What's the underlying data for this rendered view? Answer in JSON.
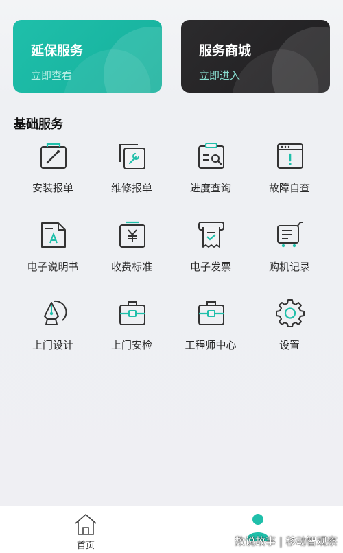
{
  "colors": {
    "accent": "#1fbfaa",
    "dark_card": "#242325",
    "icon_stroke": "#333333"
  },
  "cards": [
    {
      "title": "延保服务",
      "subtitle": "立即查看"
    },
    {
      "title": "服务商城",
      "subtitle": "立即进入"
    }
  ],
  "section": {
    "title": "基础服务"
  },
  "services": [
    {
      "label": "安装报单",
      "icon": "install-report-icon"
    },
    {
      "label": "维修报单",
      "icon": "repair-report-icon"
    },
    {
      "label": "进度查询",
      "icon": "progress-query-icon"
    },
    {
      "label": "故障自查",
      "icon": "fault-check-icon"
    },
    {
      "label": "电子说明书",
      "icon": "e-manual-icon"
    },
    {
      "label": "收费标准",
      "icon": "fee-standard-icon"
    },
    {
      "label": "电子发票",
      "icon": "e-invoice-icon"
    },
    {
      "label": "购机记录",
      "icon": "purchase-record-icon"
    },
    {
      "label": "上门设计",
      "icon": "home-design-icon"
    },
    {
      "label": "上门安检",
      "icon": "home-inspection-icon"
    },
    {
      "label": "工程师中心",
      "icon": "engineer-center-icon"
    },
    {
      "label": "设置",
      "icon": "settings-icon"
    }
  ],
  "tabbar": {
    "tabs": [
      {
        "label": "首页",
        "icon": "home-icon"
      },
      {
        "label": "",
        "icon": "profile-icon"
      }
    ]
  },
  "watermark": "数说故事 | 移动智观察"
}
